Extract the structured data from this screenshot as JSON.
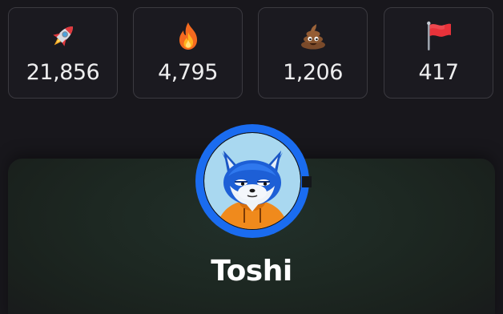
{
  "reactions": [
    {
      "icon": "rocket-icon",
      "count": "21,856"
    },
    {
      "icon": "fire-icon",
      "count": "4,795"
    },
    {
      "icon": "poop-icon",
      "count": "1,206"
    },
    {
      "icon": "red-flag-icon",
      "count": "417"
    }
  ],
  "profile": {
    "name": "Toshi",
    "avatar": "fox-avatar-icon",
    "ring_color": "#1a6cf0"
  },
  "colors": {
    "background": "#18171c",
    "card_border": "#3b3a40",
    "panel_tint": "#22302a"
  }
}
